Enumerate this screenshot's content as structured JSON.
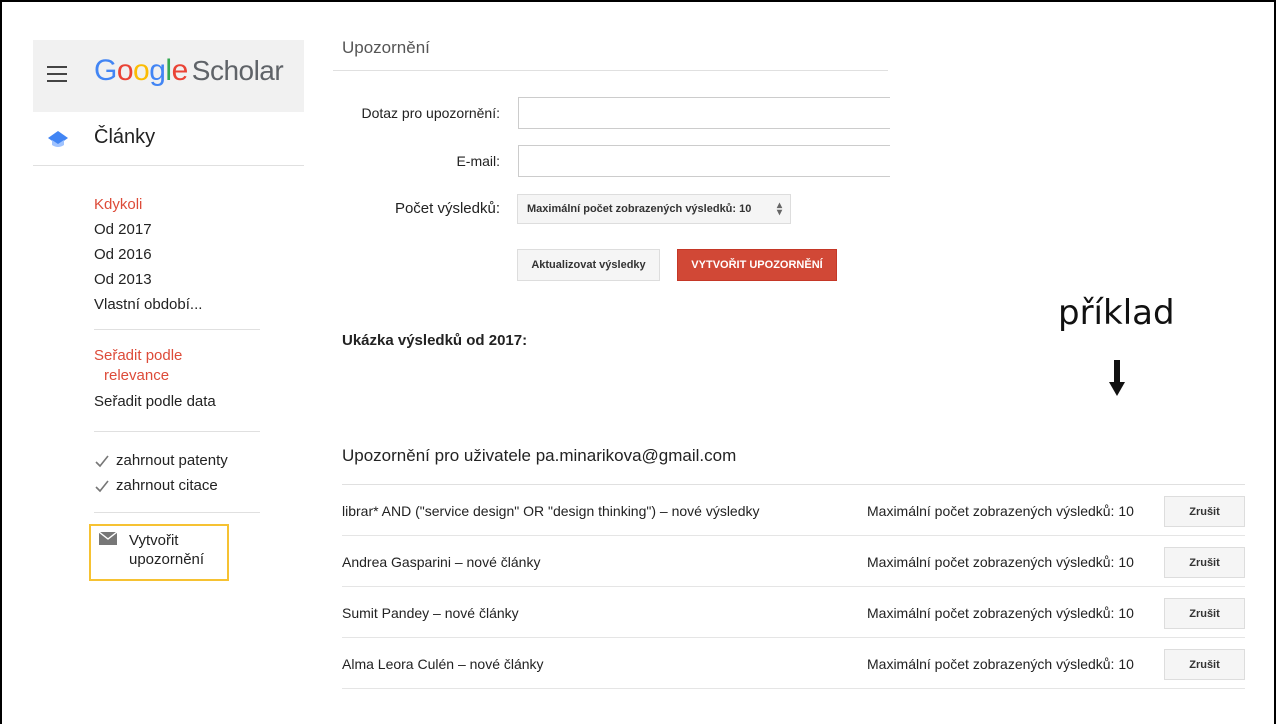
{
  "sidebar": {
    "logo_word": "Google",
    "logo_suffix": "Scholar",
    "articles_label": "Články",
    "time_filters": [
      "Kdykoli",
      "Od 2017",
      "Od 2016",
      "Od 2013",
      "Vlastní období..."
    ],
    "sort_relevance_line1": "Seřadit podle",
    "sort_relevance_line2": "relevance",
    "sort_date": "Seřadit podle data",
    "include_patents": "zahrnout patenty",
    "include_citations": "zahrnout citace",
    "create_alert_line1": "Vytvořit",
    "create_alert_line2": "upozornění"
  },
  "form": {
    "page_title": "Upozornění",
    "query_label": "Dotaz pro upozornění:",
    "query_value": "",
    "email_label": "E-mail:",
    "email_value": "",
    "results_label": "Počet výsledků:",
    "results_select": "Maximální počet zobrazených výsledků: 10",
    "update_button": "Aktualizovat výsledky",
    "create_button": "VYTVOŘIT UPOZORNĚNÍ"
  },
  "preview_title": "Ukázka výsledků od 2017:",
  "annotation": "příklad",
  "alerts": {
    "title": "Upozornění pro uživatele pa.minarikova@gmail.com",
    "cancel_label": "Zrušit",
    "rows": [
      {
        "query": "librar* AND (\"service design\" OR \"design thinking\") – nové výsledky",
        "max": "Maximální počet zobrazených výsledků: 10"
      },
      {
        "query": "Andrea Gasparini – nové články",
        "max": "Maximální počet zobrazených výsledků: 10"
      },
      {
        "query": "Sumit Pandey – nové články",
        "max": "Maximální počet zobrazených výsledků: 10"
      },
      {
        "query": "Alma Leora Culén – nové články",
        "max": "Maximální počet zobrazených výsledků: 10"
      }
    ]
  },
  "colors": {
    "accent_red": "#dd4b39",
    "highlight_border": "#f6c232",
    "button_red": "#d14836"
  },
  "icons": [
    "menu-icon",
    "graduation-cap-icon",
    "checkmark-icon",
    "mail-icon",
    "arrow-down-icon",
    "select-arrows-icon"
  ]
}
